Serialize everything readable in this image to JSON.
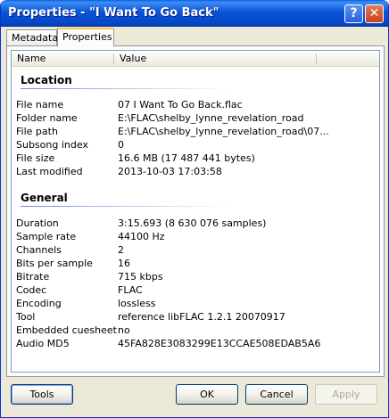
{
  "window": {
    "title": "Properties - \"I Want To Go Back\"",
    "help_glyph": "?",
    "close_glyph": "✕"
  },
  "tabs": [
    {
      "label": "Metadata",
      "active": false
    },
    {
      "label": "Properties",
      "active": true
    }
  ],
  "columns": {
    "name": "Name",
    "value": "Value"
  },
  "groups": [
    {
      "title": "Location",
      "rows": [
        {
          "key": "File name",
          "value": "07 I Want To Go Back.flac"
        },
        {
          "key": "Folder name",
          "value": "E:\\FLAC\\shelby_lynne_revelation_road"
        },
        {
          "key": "File path",
          "value": "E:\\FLAC\\shelby_lynne_revelation_road\\07..."
        },
        {
          "key": "Subsong index",
          "value": "0"
        },
        {
          "key": "File size",
          "value": "16.6 MB (17 487 441 bytes)"
        },
        {
          "key": "Last modified",
          "value": "2013-10-03 17:03:58"
        }
      ]
    },
    {
      "title": "General",
      "rows": [
        {
          "key": "Duration",
          "value": "3:15.693 (8 630 076 samples)"
        },
        {
          "key": "Sample rate",
          "value": "44100 Hz"
        },
        {
          "key": "Channels",
          "value": "2"
        },
        {
          "key": "Bits per sample",
          "value": "16"
        },
        {
          "key": "Bitrate",
          "value": "715 kbps"
        },
        {
          "key": "Codec",
          "value": "FLAC"
        },
        {
          "key": "Encoding",
          "value": "lossless"
        },
        {
          "key": "Tool",
          "value": "reference libFLAC 1.2.1 20070917"
        },
        {
          "key": "Embedded cuesheet",
          "value": "no"
        },
        {
          "key": "Audio MD5",
          "value": "45FA828E3083299E13CCAE508EDAB5A6"
        }
      ]
    }
  ],
  "buttons": {
    "tools": "Tools",
    "ok": "OK",
    "cancel": "Cancel",
    "apply": "Apply"
  },
  "colors": {
    "titlebar": "#0a54d6",
    "tab_highlight": "#ffc73c",
    "group_line": "#6d8fd0"
  }
}
